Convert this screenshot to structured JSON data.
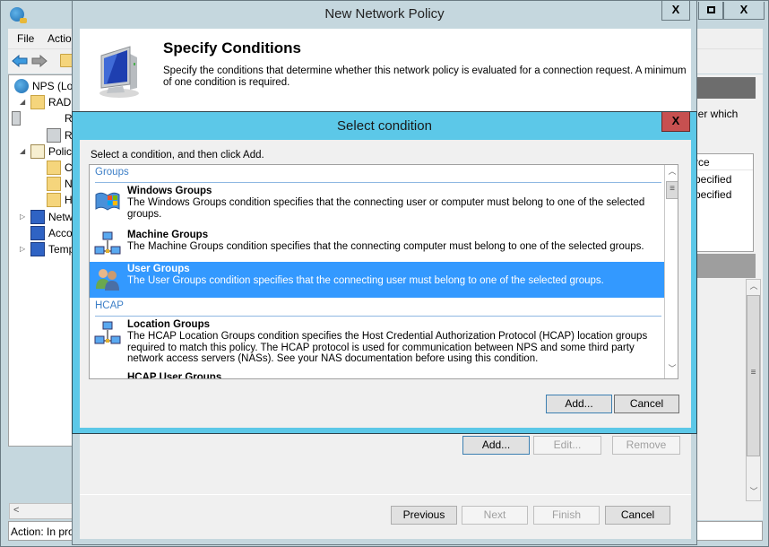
{
  "mmc": {
    "menu": [
      "File",
      "Actio"
    ],
    "tree": [
      {
        "label": "NPS (Loc",
        "expander": "",
        "icon": "nps-globe-icon",
        "indent": 0
      },
      {
        "label": "RADIU",
        "expander": "◢",
        "icon": "folder-icon",
        "indent": 1
      },
      {
        "label": "R",
        "expander": "",
        "icon": "server-icon",
        "indent": 2
      },
      {
        "label": "R",
        "expander": "",
        "icon": "server-group-icon",
        "indent": 2
      },
      {
        "label": "Polici",
        "expander": "◢",
        "icon": "policy-scroll-icon",
        "indent": 1
      },
      {
        "label": "C",
        "expander": "",
        "icon": "folder-icon",
        "indent": 2
      },
      {
        "label": "N",
        "expander": "",
        "icon": "network-policy-folder-icon",
        "indent": 2
      },
      {
        "label": "H",
        "expander": "",
        "icon": "folder-icon",
        "indent": 2
      },
      {
        "label": "Netw",
        "expander": "▷",
        "icon": "network-access-icon",
        "indent": 1
      },
      {
        "label": "Acco",
        "expander": "",
        "icon": "accounting-icon",
        "indent": 1
      },
      {
        "label": "Temp",
        "expander": "▷",
        "icon": "templates-icon",
        "indent": 1
      }
    ],
    "status": "Action:  In pro",
    "right_pane": {
      "text": "ler which",
      "column_header": "rce",
      "cells": [
        "pecified",
        "pecified"
      ]
    }
  },
  "wizard": {
    "title": "New Network Policy",
    "close_label": "X",
    "heading": "Specify Conditions",
    "description": "Specify the conditions that determine whether this network policy is evaluated for a connection request. A minimum of one condition is required.",
    "condition_buttons": {
      "add": "Add...",
      "edit": "Edit...",
      "remove": "Remove"
    },
    "nav_buttons": {
      "previous": "Previous",
      "next": "Next",
      "finish": "Finish",
      "cancel": "Cancel"
    }
  },
  "select_dialog": {
    "title": "Select condition",
    "close_label": "X",
    "instruction": "Select a condition, and then click Add.",
    "groups": [
      {
        "header": "Groups",
        "conditions": [
          {
            "name": "Windows Groups",
            "description": "The Windows Groups condition specifies that the connecting user or computer must belong to one of the selected groups.",
            "icon": "windows-groups-icon",
            "selected": false
          },
          {
            "name": "Machine Groups",
            "description": "The Machine Groups condition specifies that the connecting computer must belong to one of the selected groups.",
            "icon": "machine-groups-icon",
            "selected": false
          },
          {
            "name": "User Groups",
            "description": "The User Groups condition specifies that the connecting user must belong to one of the selected groups.",
            "icon": "user-groups-icon",
            "selected": true
          }
        ]
      },
      {
        "header": "HCAP",
        "conditions": [
          {
            "name": "Location Groups",
            "description": "The HCAP Location Groups condition specifies the Host Credential Authorization Protocol (HCAP) location groups required to match this policy. The HCAP protocol is used for communication between NPS and some third party network access servers (NASs). See your NAS documentation before using this condition.",
            "icon": "location-groups-icon",
            "selected": false
          },
          {
            "name": "HCAP User Groups",
            "description": "",
            "icon": "hcap-user-groups-icon",
            "selected": false
          }
        ]
      }
    ],
    "buttons": {
      "add": "Add...",
      "cancel": "Cancel"
    }
  },
  "colors": {
    "selection": "#3399ff",
    "dialog_frame": "#5cc8e8",
    "close_red": "#c75050",
    "group_header": "#3d7fc7"
  }
}
